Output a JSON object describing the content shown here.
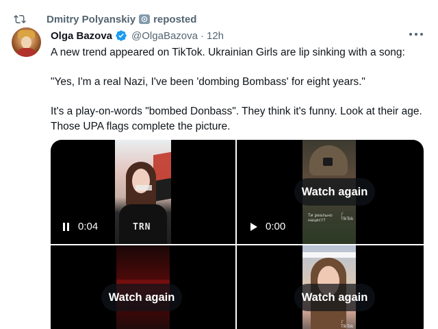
{
  "repost": {
    "user": "Dmitry Polyanskiy",
    "action": "reposted"
  },
  "tweet": {
    "author_name": "Olga Bazova",
    "handle": "@OlgaBazova",
    "separator": "·",
    "time": "12h",
    "paragraphs": [
      "A new trend appeared on TikTok. Ukrainian Girls are lip sinking with a song:",
      "\"Yes, I'm a real Nazi, I've been 'dombing Bombass' for eight years.\"",
      "It's a play-on-words \"bombed Donbass\". They think it's funny. Look at their age. Those UPA flags complete the picture."
    ]
  },
  "media": {
    "videos": [
      {
        "state": "playing",
        "time": "0:04",
        "overlay": ""
      },
      {
        "state": "ended",
        "time": "0:00",
        "overlay": "Watch again"
      },
      {
        "state": "ended",
        "time": "",
        "overlay": "Watch again"
      },
      {
        "state": "ended",
        "time": "",
        "overlay": "Watch again"
      }
    ]
  },
  "colors": {
    "text": "#0f1419",
    "secondary": "#536471",
    "verified": "#1d9bf0",
    "badge": "#829aab"
  }
}
